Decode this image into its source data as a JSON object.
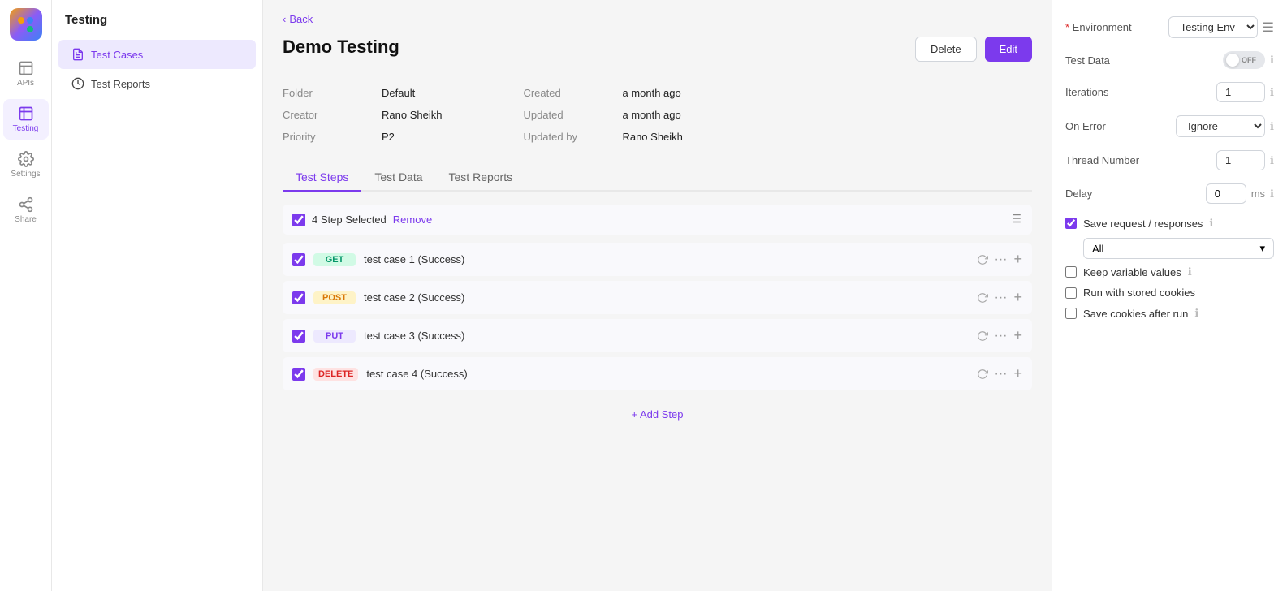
{
  "app": {
    "logo_dots": [
      "#f59e0b",
      "#3b82f6",
      "#8b5cf6",
      "#10b981"
    ]
  },
  "icon_nav": {
    "items": [
      {
        "id": "apis",
        "label": "APIs",
        "active": false
      },
      {
        "id": "testing",
        "label": "Testing",
        "active": true
      },
      {
        "id": "settings",
        "label": "Settings",
        "active": false
      },
      {
        "id": "share",
        "label": "Share",
        "active": false
      }
    ]
  },
  "sidebar": {
    "title": "Testing",
    "items": [
      {
        "id": "test-cases",
        "label": "Test Cases",
        "active": true
      },
      {
        "id": "test-reports",
        "label": "Test Reports",
        "active": false
      }
    ]
  },
  "back_link": "< Back",
  "page": {
    "title": "Demo Testing",
    "meta_left": [
      {
        "label": "Folder",
        "value": "Default"
      },
      {
        "label": "Creator",
        "value": "Rano Sheikh"
      },
      {
        "label": "Priority",
        "value": "P2"
      }
    ],
    "meta_right": [
      {
        "label": "Created",
        "value": "a month ago"
      },
      {
        "label": "Updated",
        "value": "a month ago"
      },
      {
        "label": "Updated by",
        "value": "Rano Sheikh"
      }
    ]
  },
  "tabs": [
    {
      "id": "test-steps",
      "label": "Test Steps",
      "active": true
    },
    {
      "id": "test-data",
      "label": "Test Data",
      "active": false
    },
    {
      "id": "test-reports",
      "label": "Test Reports",
      "active": false
    }
  ],
  "steps_header": {
    "selected_count": "4 Step Selected",
    "remove_label": "Remove"
  },
  "steps": [
    {
      "id": "step1",
      "method": "GET",
      "method_class": "method-get",
      "name": "test case 1 (Success)",
      "checked": true
    },
    {
      "id": "step2",
      "method": "POST",
      "method_class": "method-post",
      "name": "test case 2 (Success)",
      "checked": true
    },
    {
      "id": "step3",
      "method": "PUT",
      "method_class": "method-put",
      "name": "test case 3 (Success)",
      "checked": true
    },
    {
      "id": "step4",
      "method": "DELETE",
      "method_class": "method-delete",
      "name": "test case 4 (Success)",
      "checked": true
    }
  ],
  "add_step_label": "+ Add Step",
  "right_panel": {
    "environment_label": "Environment",
    "environment_value": "Testing Env",
    "test_data_label": "Test Data",
    "test_data_toggle": "OFF",
    "iterations_label": "Iterations",
    "iterations_value": "1",
    "on_error_label": "On Error",
    "on_error_value": "Ignore",
    "thread_number_label": "Thread Number",
    "thread_number_value": "1",
    "delay_label": "Delay",
    "delay_value": "0",
    "delay_unit": "ms",
    "save_requests_label": "Save request / responses",
    "save_requests_checked": true,
    "save_requests_option": "All",
    "keep_variable_label": "Keep variable values",
    "keep_variable_checked": false,
    "run_stored_cookies_label": "Run with stored cookies",
    "run_stored_cookies_checked": false,
    "save_cookies_label": "Save cookies after run",
    "save_cookies_checked": false
  },
  "buttons": {
    "delete_label": "Delete",
    "edit_label": "Edit"
  }
}
